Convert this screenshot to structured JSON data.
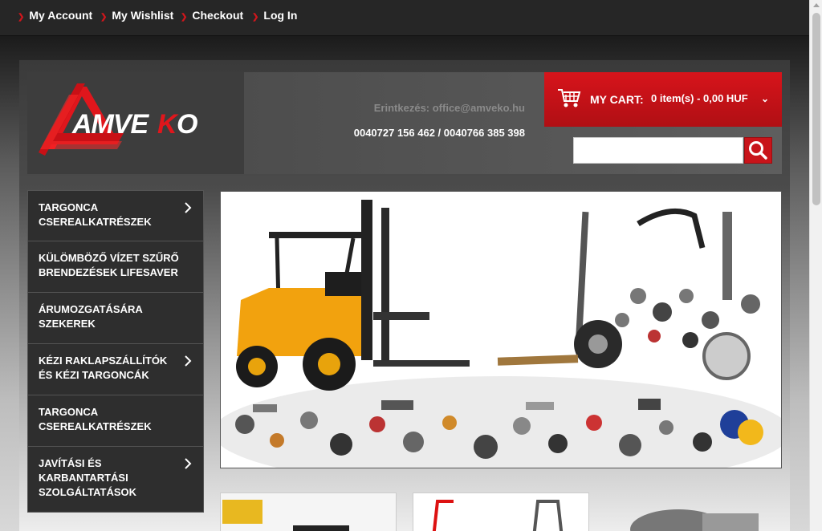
{
  "topbar": {
    "links": [
      {
        "label": "My Account"
      },
      {
        "label": "My Wishlist"
      },
      {
        "label": "Checkout"
      },
      {
        "label": "Log In"
      }
    ]
  },
  "header": {
    "logo_alt": "AMVEKO",
    "contact_email": "Erintkezés: office@amveko.hu",
    "contact_phone": "0040727 156 462 / 0040766 385 398"
  },
  "cart": {
    "label": "MY CART:",
    "value": "0 item(s) - 0,00 HUF"
  },
  "search": {
    "placeholder": ""
  },
  "categories": [
    {
      "label": "TARGONCA CSEREALKATRÉSZEK",
      "has_children": true
    },
    {
      "label": "KÜLÖMBÖZŐ VÍZET SZŰRŐ BRENDEZÉSEK LIFESAVER",
      "has_children": false
    },
    {
      "label": "ÁRUMOZGATÁSÁRA SZEKEREK",
      "has_children": false
    },
    {
      "label": "KÉZI RAKLAPSZÁLLÍTÓK ÉS KÉZI TARGONCÁK",
      "has_children": true
    },
    {
      "label": "TARGONCA CSEREALKATRÉSZEK",
      "has_children": false
    },
    {
      "label": "JAVÍTÁSI ÉS KARBANTARTÁSI SZOLGÁLTATÁSOK",
      "has_children": true
    }
  ],
  "colors": {
    "accent": "#d7141b",
    "dark": "#2e2e2e"
  },
  "icons": {
    "cart": "shopping-cart-icon",
    "search": "search-icon",
    "chevron": "chevron-right-icon"
  }
}
